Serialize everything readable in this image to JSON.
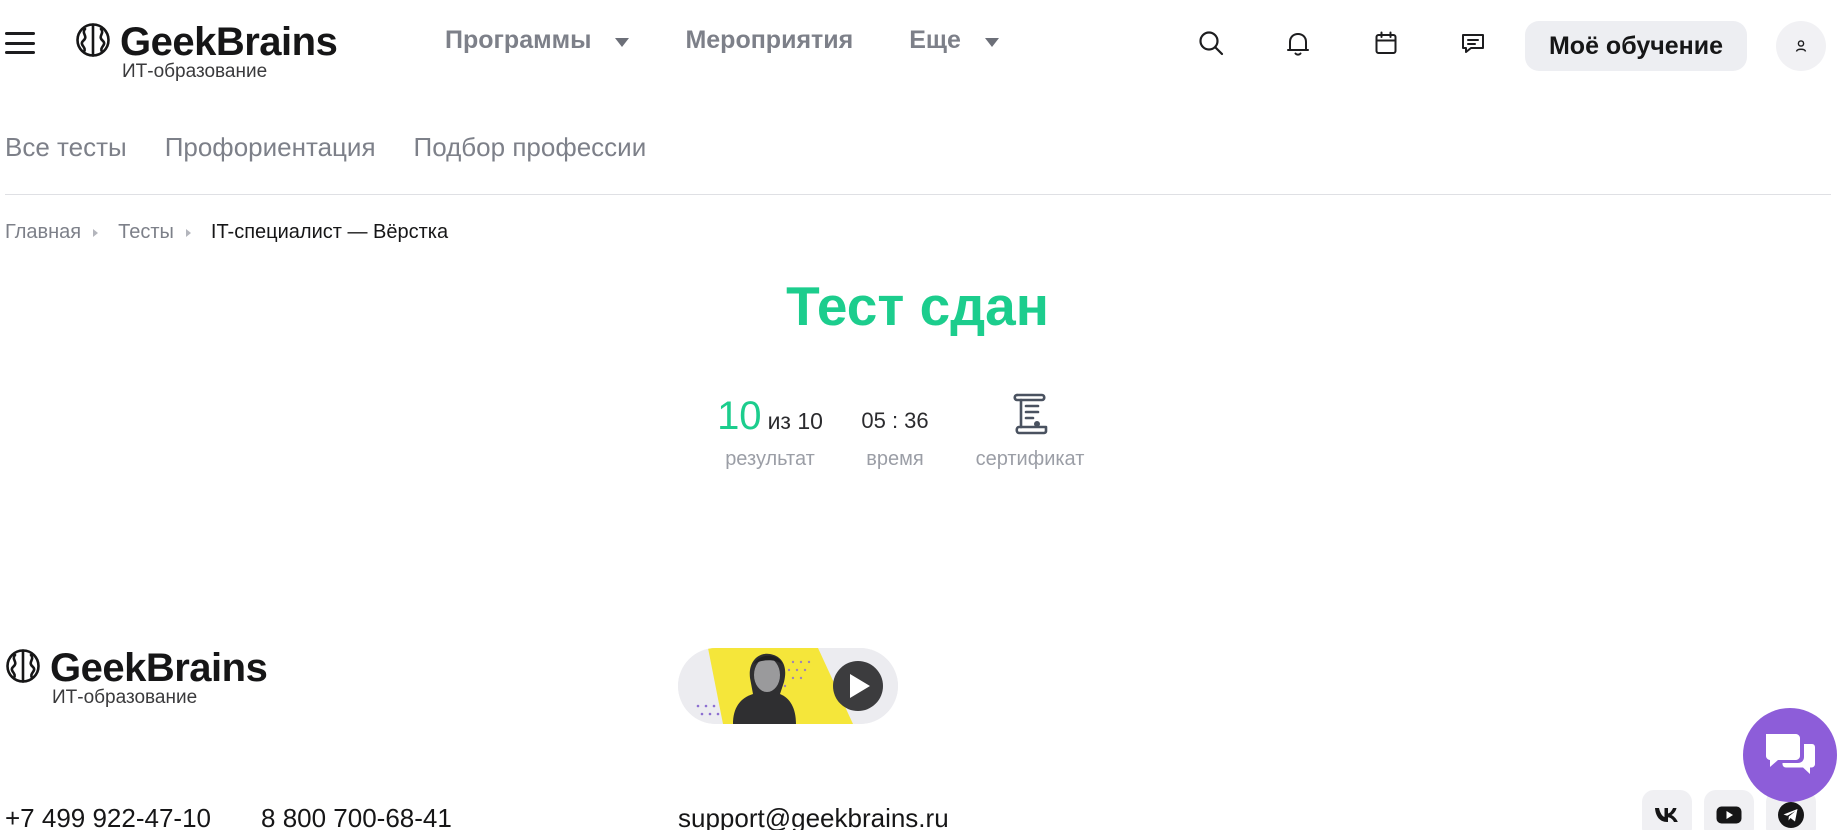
{
  "header": {
    "logo": {
      "brand": "GeekBrains",
      "subtitle": "ИТ-образование"
    },
    "nav": [
      {
        "label": "Программы",
        "has_dropdown": true
      },
      {
        "label": "Мероприятия",
        "has_dropdown": false
      },
      {
        "label": "Еще",
        "has_dropdown": true
      }
    ],
    "icons": [
      "search-icon",
      "bell-icon",
      "calendar-icon",
      "chat-icon"
    ],
    "my_learning_label": "Моё обучение",
    "avatar_icon": "user-icon"
  },
  "subnav": {
    "items": [
      "Все тесты",
      "Профориентация",
      "Подбор профессии"
    ]
  },
  "breadcrumb": {
    "items": [
      "Главная",
      "Тесты"
    ],
    "current": "IT-специалист — Вёрстка"
  },
  "result": {
    "title": "Тест сдан",
    "score": "10",
    "score_total": "из 10",
    "score_label": "результат",
    "time": "05 : 36",
    "time_label": "время",
    "certificate_label": "сертификат",
    "certificate_icon": "certificate-scroll-icon"
  },
  "footer": {
    "logo": {
      "brand": "GeekBrains",
      "subtitle": "ИТ-образование"
    },
    "video_icon": "play-icon",
    "phones": [
      "+7 499 922-47-10",
      "8 800 700-68-41"
    ],
    "email": "support@geekbrains.ru",
    "social": [
      "vk-icon",
      "youtube-icon",
      "telegram-icon"
    ]
  },
  "chat_widget_icon": "chat-bubbles-icon",
  "colors": {
    "accent_green": "#1ccd8d",
    "chat_purple": "#8d5dd9",
    "muted_text": "#7d8089",
    "video_yellow": "#f5e63a"
  }
}
